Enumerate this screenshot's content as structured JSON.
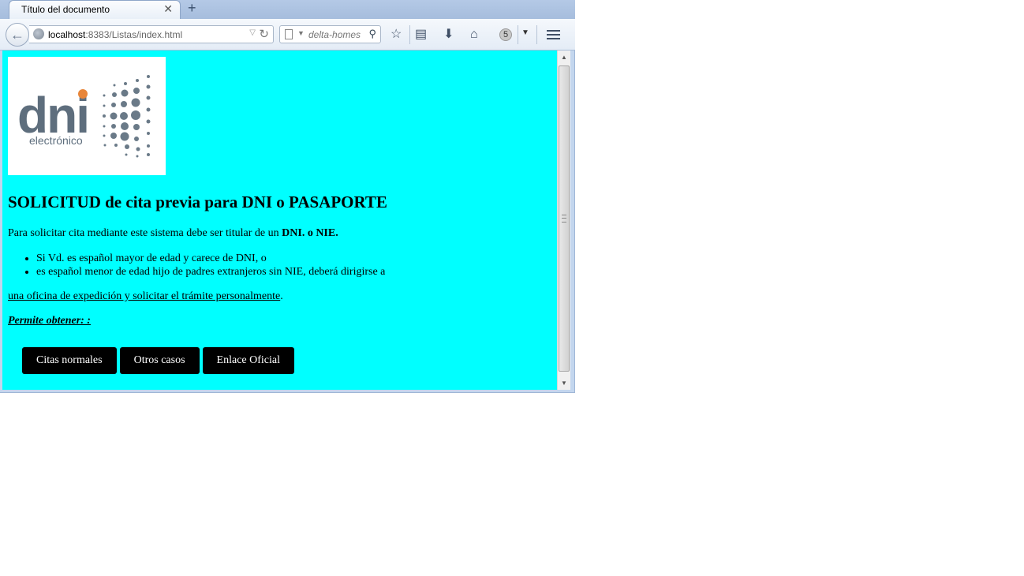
{
  "tab": {
    "title": "Título del documento",
    "close_icon": "close-icon",
    "new_tab_icon": "plus-icon"
  },
  "navbar": {
    "url_host": "localhost",
    "url_rest": ":8383/Listas/index.html",
    "search_placeholder": "delta-homes",
    "badge_count": "5"
  },
  "page": {
    "logo_word": "dni",
    "logo_sub": "electrónico",
    "heading": "SOLICITUD de cita previa para DNI o PASAPORTE",
    "intro_text": "Para solicitar cita mediante este sistema debe ser titular de un ",
    "intro_bold": "DNI. o NIE.",
    "list": [
      "Si Vd. es español mayor de edad y carece de DNI, o",
      "es español menor de edad hijo de padres extranjeros sin NIE, deberá dirigirse a"
    ],
    "office_link": "una oficina de expedición y solicitar el trámite personalmente",
    "office_suffix": ".",
    "permite": "Permite obtener: :",
    "buttons": [
      "Citas normales",
      "Otros casos",
      "Enlace Oficial"
    ]
  },
  "colors": {
    "page_background": "#00ffff",
    "button_background": "#000000",
    "logo_accent": "#e8863a",
    "logo_gray": "#5e6e7d"
  }
}
